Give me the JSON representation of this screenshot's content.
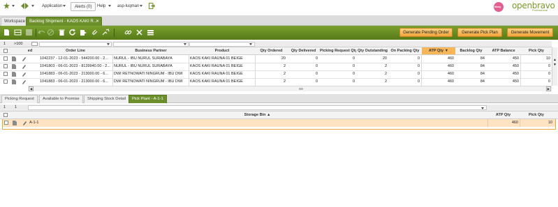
{
  "topnav": {
    "application_label": "Application",
    "alerts_label": "Alerts (0)",
    "help_label": "Help",
    "user_label": "asp-luqman",
    "brand_name": "openbravo",
    "brand_sub": "Professional",
    "client_logo_text": "Nicky"
  },
  "tabs": {
    "workspace": "Workspace",
    "active": "Backlog Shipment - KAOS KAKI R..."
  },
  "toolbar": {
    "generate_pending": "Generate Pending Order",
    "generate_pick": "Generate Pick Plan",
    "generate_movement": "Generate Movement"
  },
  "grid": {
    "count": "1",
    "page": ">100",
    "columns": {
      "ed": "ed",
      "order_line": "Order Line",
      "business_partner": "Business Partner",
      "product": "Product",
      "qty_ordered": "Qty Ordered",
      "qty_delivered": "Qty Delivered",
      "picking_request_qty": "Picking Request Qty",
      "qty_outstanding": "Qty Outstanding",
      "on_packing_qty": "On Packing Qty",
      "atp_qty": "ATP Qty",
      "backlog_qty": "Backlog Qty",
      "atp_balance": "ATP Balance",
      "pick_qty": "Pick Qty"
    },
    "rows": [
      {
        "order_line": "1042237 - 12-01-2023 - 544200.00 - 2...",
        "bp": "NURUL - IBU NURUL SURABAYA",
        "product": "KAOS KAKI RAUNA 01 BEIGE",
        "qty_ordered": "20",
        "qty_delivered": "0",
        "picking_request_qty": "0",
        "qty_outstanding": "20",
        "on_packing_qty": "0",
        "atp_qty": "460",
        "backlog_qty": "84",
        "atp_balance": "450",
        "pick_qty": "10"
      },
      {
        "order_line": "1041803 - 06-01-2023 - 8139940.00 - 2...",
        "bp": "NURUL - IBU NURUL SURABAYA",
        "product": "KAOS KAKI RAUNA 01 BEIGE",
        "qty_ordered": "2",
        "qty_delivered": "0",
        "picking_request_qty": "0",
        "qty_outstanding": "2",
        "on_packing_qty": "0",
        "atp_qty": "460",
        "backlog_qty": "84",
        "atp_balance": "450",
        "pick_qty": "0"
      },
      {
        "order_line": "1041883 - 06-01-2023 - 213000.00 - 6...",
        "bp": "DWI RETNOWATI NINGRUM - IBU DWI",
        "product": "KAOS KAKI RAUNA 01 BEIGE",
        "qty_ordered": "2",
        "qty_delivered": "0",
        "picking_request_qty": "0",
        "qty_outstanding": "2",
        "on_packing_qty": "0",
        "atp_qty": "460",
        "backlog_qty": "84",
        "atp_balance": "450",
        "pick_qty": "0"
      },
      {
        "order_line": "1041883 - 06-01-2023 - 213000.00 - 6...",
        "bp": "DWI RETNOWATI NINGRUM - IBU DWI",
        "product": "KAOS KAKI RAUNA 01 BEIGE",
        "qty_ordered": "2",
        "qty_delivered": "0",
        "picking_request_qty": "0",
        "qty_outstanding": "2",
        "on_packing_qty": "0",
        "atp_qty": "460",
        "backlog_qty": "84",
        "atp_balance": "450",
        "pick_qty": "0"
      }
    ]
  },
  "subtabs": [
    "Picking Request",
    "Available to Promise",
    "Shipping Stock Detail",
    "Pick Plant - A-1-1"
  ],
  "subgrid": {
    "count": "1",
    "page": "1",
    "columns": {
      "storage_bin": "Storage Bin ▲",
      "atp_qty": "ATP Qty",
      "pick_qty": "Pick Qty"
    },
    "rows": [
      {
        "storage_bin": "A-1-1",
        "atp_qty": "460",
        "pick_qty": "10"
      }
    ]
  },
  "colors": {
    "green": "#6c8f2b",
    "orange": "#f2a43a",
    "selected_row": "#fde3c2"
  }
}
